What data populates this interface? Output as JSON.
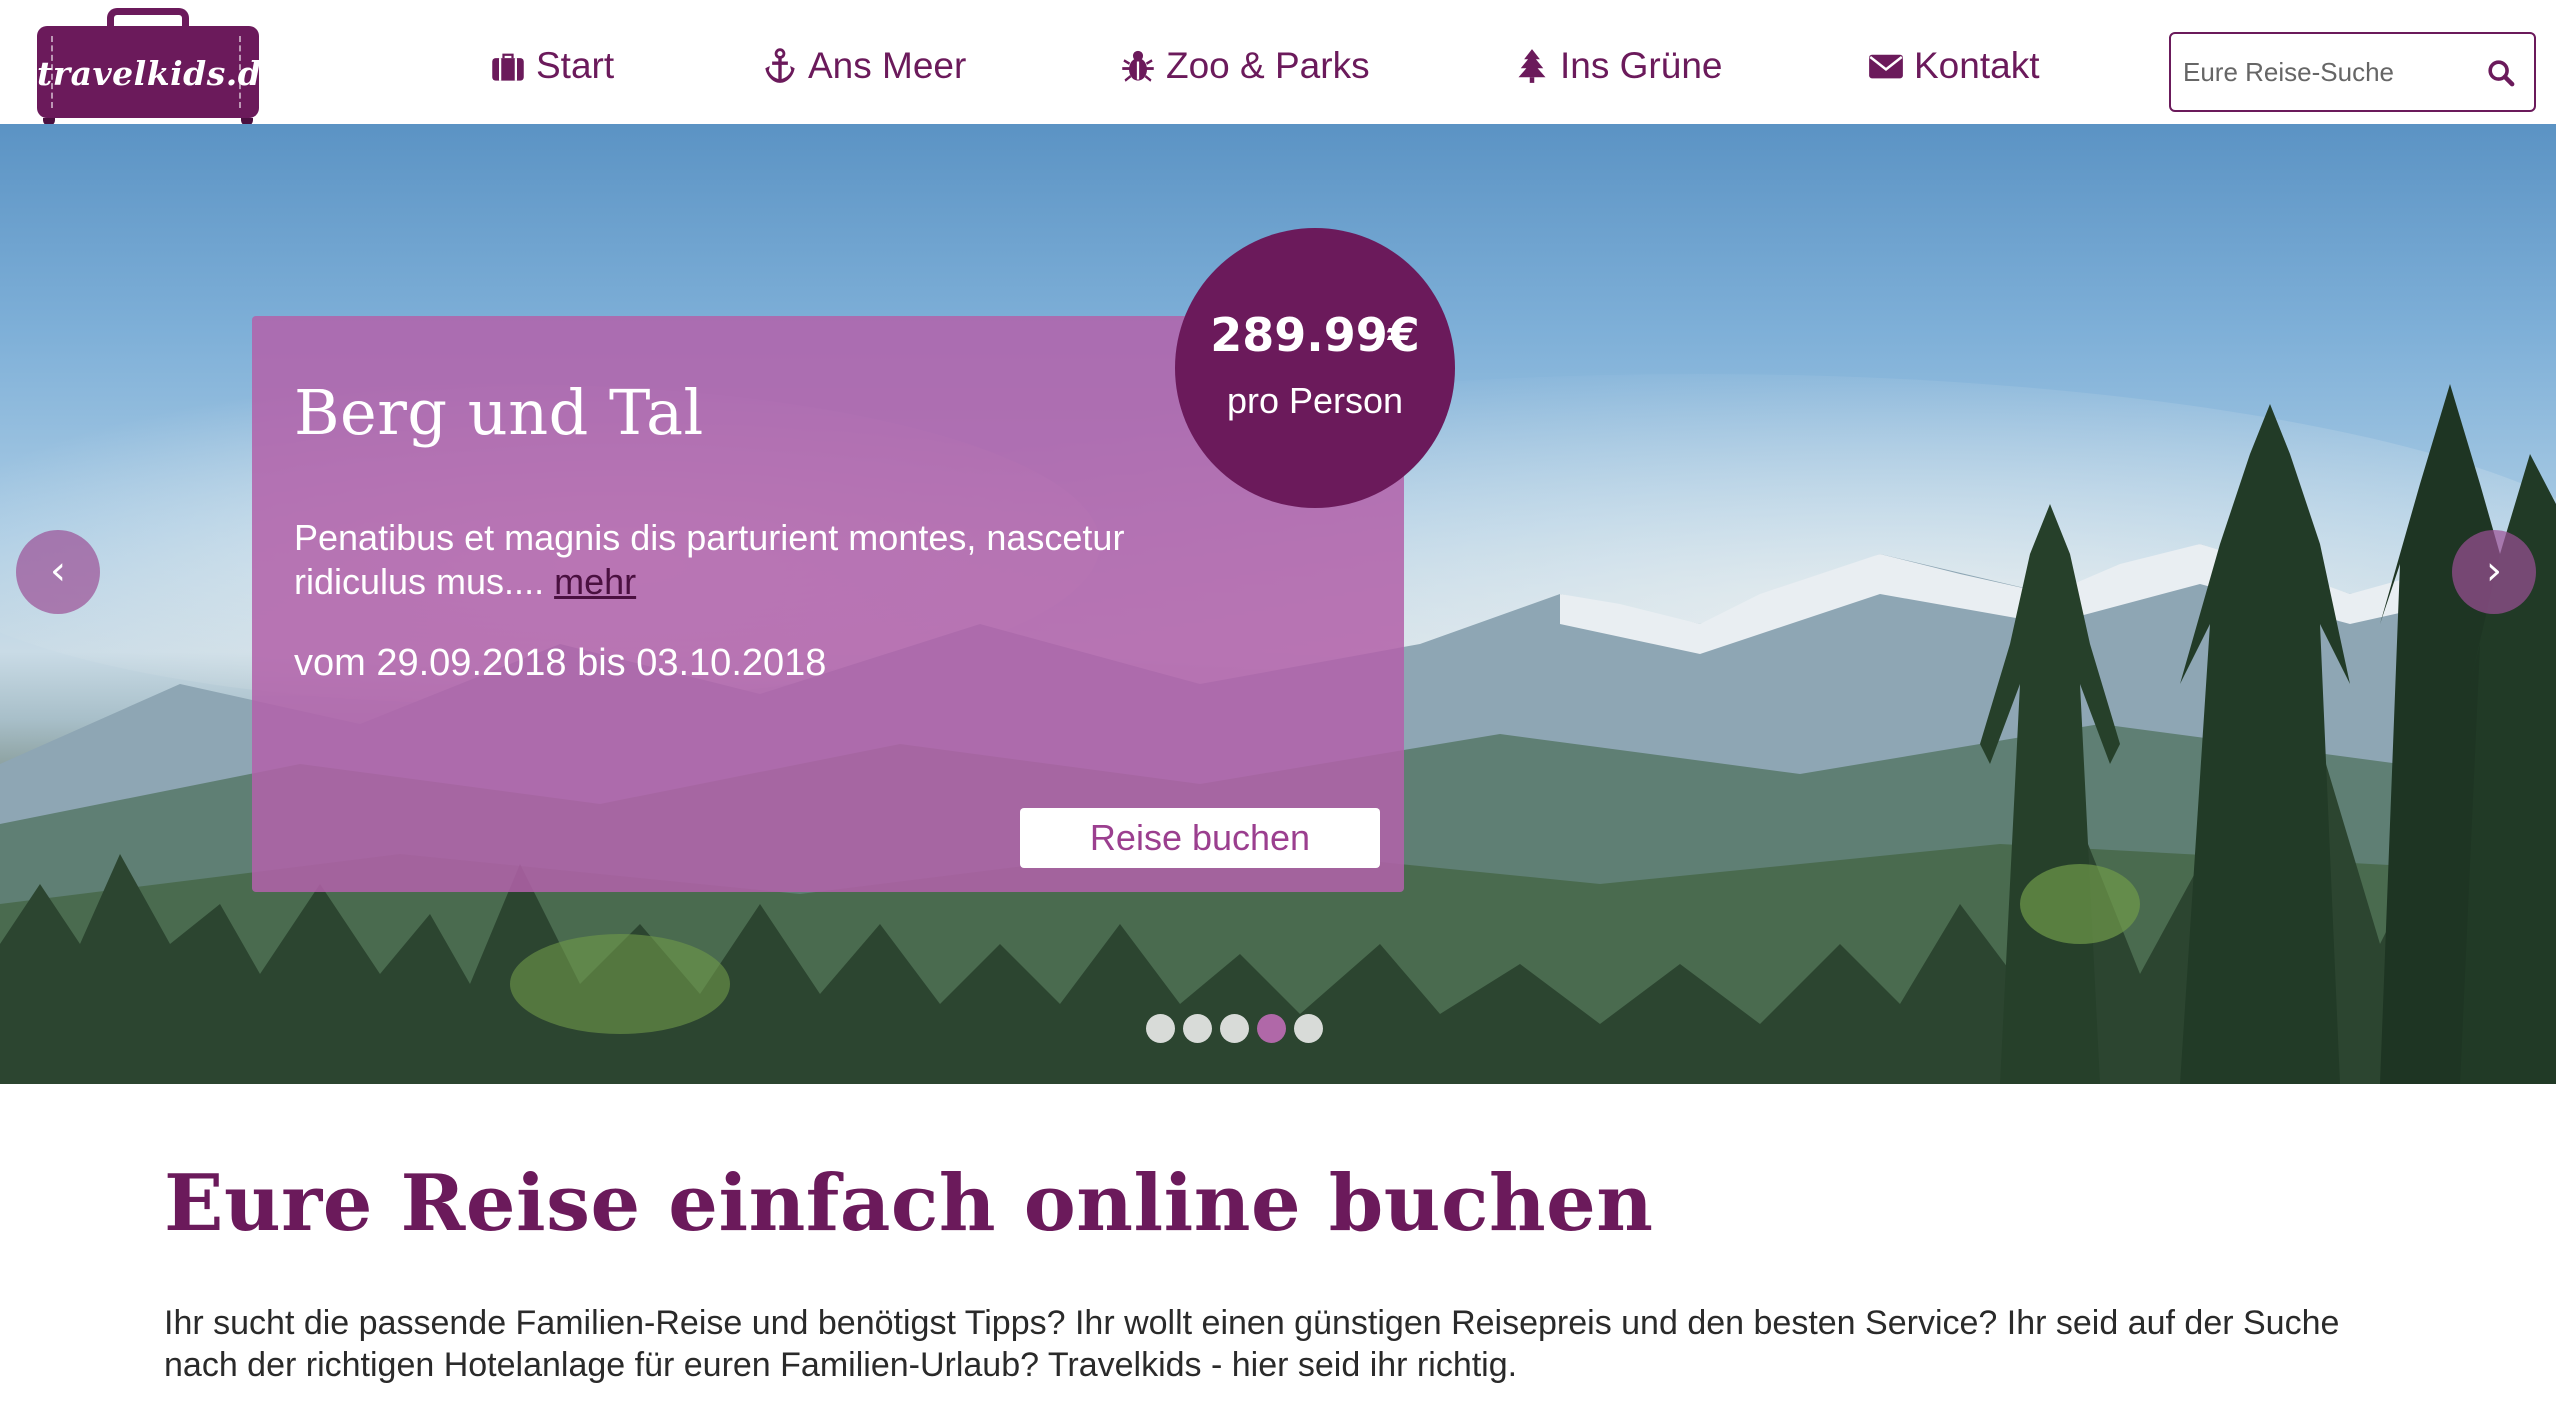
{
  "brand": {
    "logo_text": "travelkids.de",
    "accent_color": "#6b1a5b",
    "light_accent": "#b262aa"
  },
  "nav": {
    "items": [
      {
        "label": "Start",
        "icon": "suitcase-icon"
      },
      {
        "label": "Ans Meer",
        "icon": "anchor-icon"
      },
      {
        "label": "Zoo & Parks",
        "icon": "bug-icon"
      },
      {
        "label": "Ins Grüne",
        "icon": "tree-icon"
      },
      {
        "label": "Kontakt",
        "icon": "envelope-icon"
      }
    ]
  },
  "search": {
    "placeholder": "Eure Reise-Suche",
    "value": ""
  },
  "hero": {
    "title": "Berg und Tal",
    "description": "Penatibus et magnis dis parturient montes, nascetur ridiculus mus....",
    "more_link": "mehr",
    "dates": "vom 29.09.2018 bis 03.10.2018",
    "price": "289.99€",
    "price_unit": "pro Person",
    "book_button": "Reise buchen",
    "prev_arrow": "‹",
    "next_arrow": "›",
    "slides_count": 5,
    "active_slide": 4
  },
  "content": {
    "title": "Eure Reise einfach online buchen",
    "text": "Ihr sucht die passende Familien-Reise und benötigst Tipps? Ihr wollt einen günstigen Reisepreis und den besten Service? Ihr seid auf der Suche nach der richtigen Hotelanlage für euren Familien-Urlaub? Travelkids - hier seid ihr richtig."
  }
}
